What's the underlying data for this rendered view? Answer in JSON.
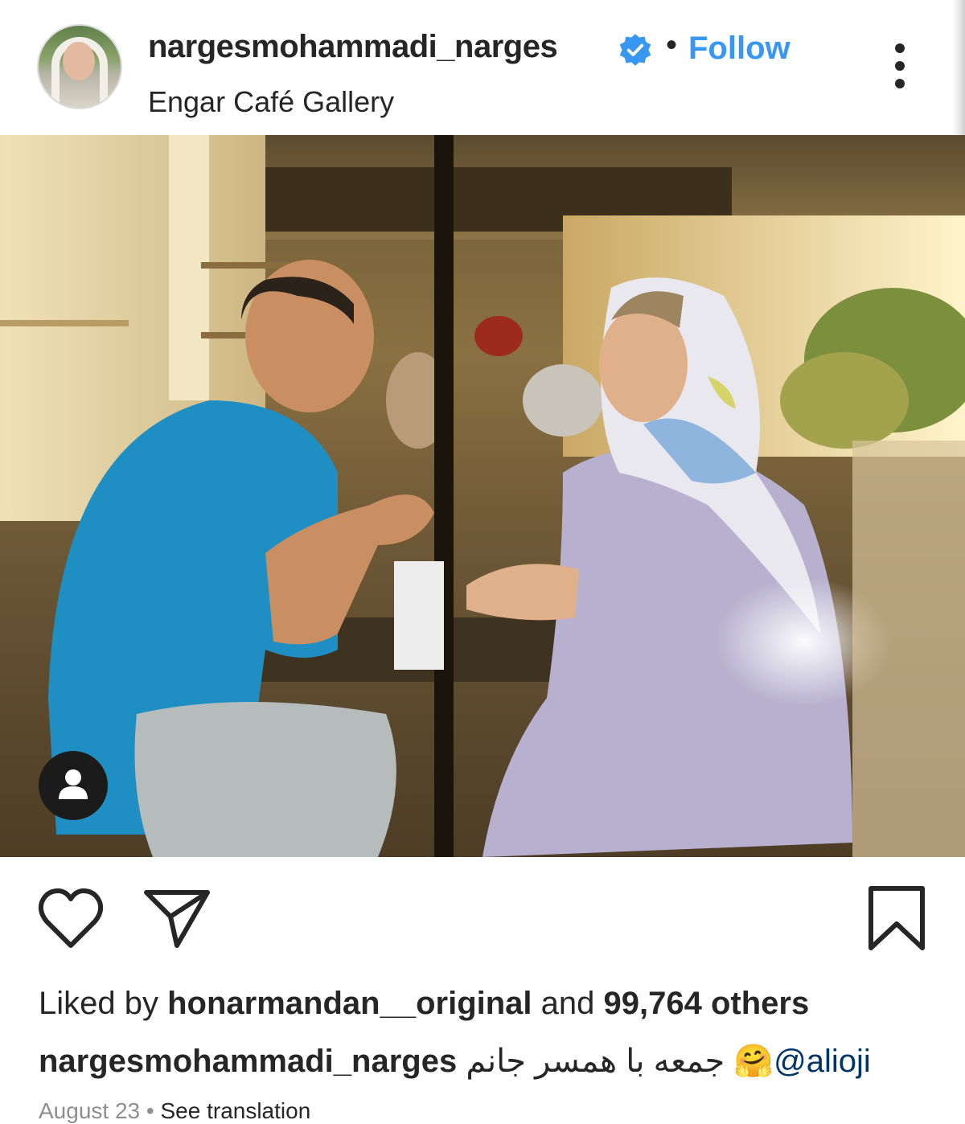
{
  "post": {
    "username": "nargesmohammadi_narges",
    "verified_icon": "verified-badge-icon",
    "separator": "•",
    "follow_label": "Follow",
    "location": "Engar Café Gallery",
    "photo_description_icon": "post-photo",
    "likes": {
      "prefix": "Liked by ",
      "liker": "honarmandan__original",
      "middle": " and ",
      "count_text": "99,764 others"
    },
    "caption": {
      "author": "nargesmohammadi_narges",
      "text": "جمعه با همسر جانم",
      "emoji": "🤗",
      "mention": "@alioji"
    },
    "date": "August 23",
    "date_separator": " • ",
    "see_translation": "See translation"
  },
  "colors": {
    "link_blue": "#3897f0",
    "verified_blue": "#3897f0",
    "text": "#262626",
    "muted": "#8e8e8e"
  }
}
